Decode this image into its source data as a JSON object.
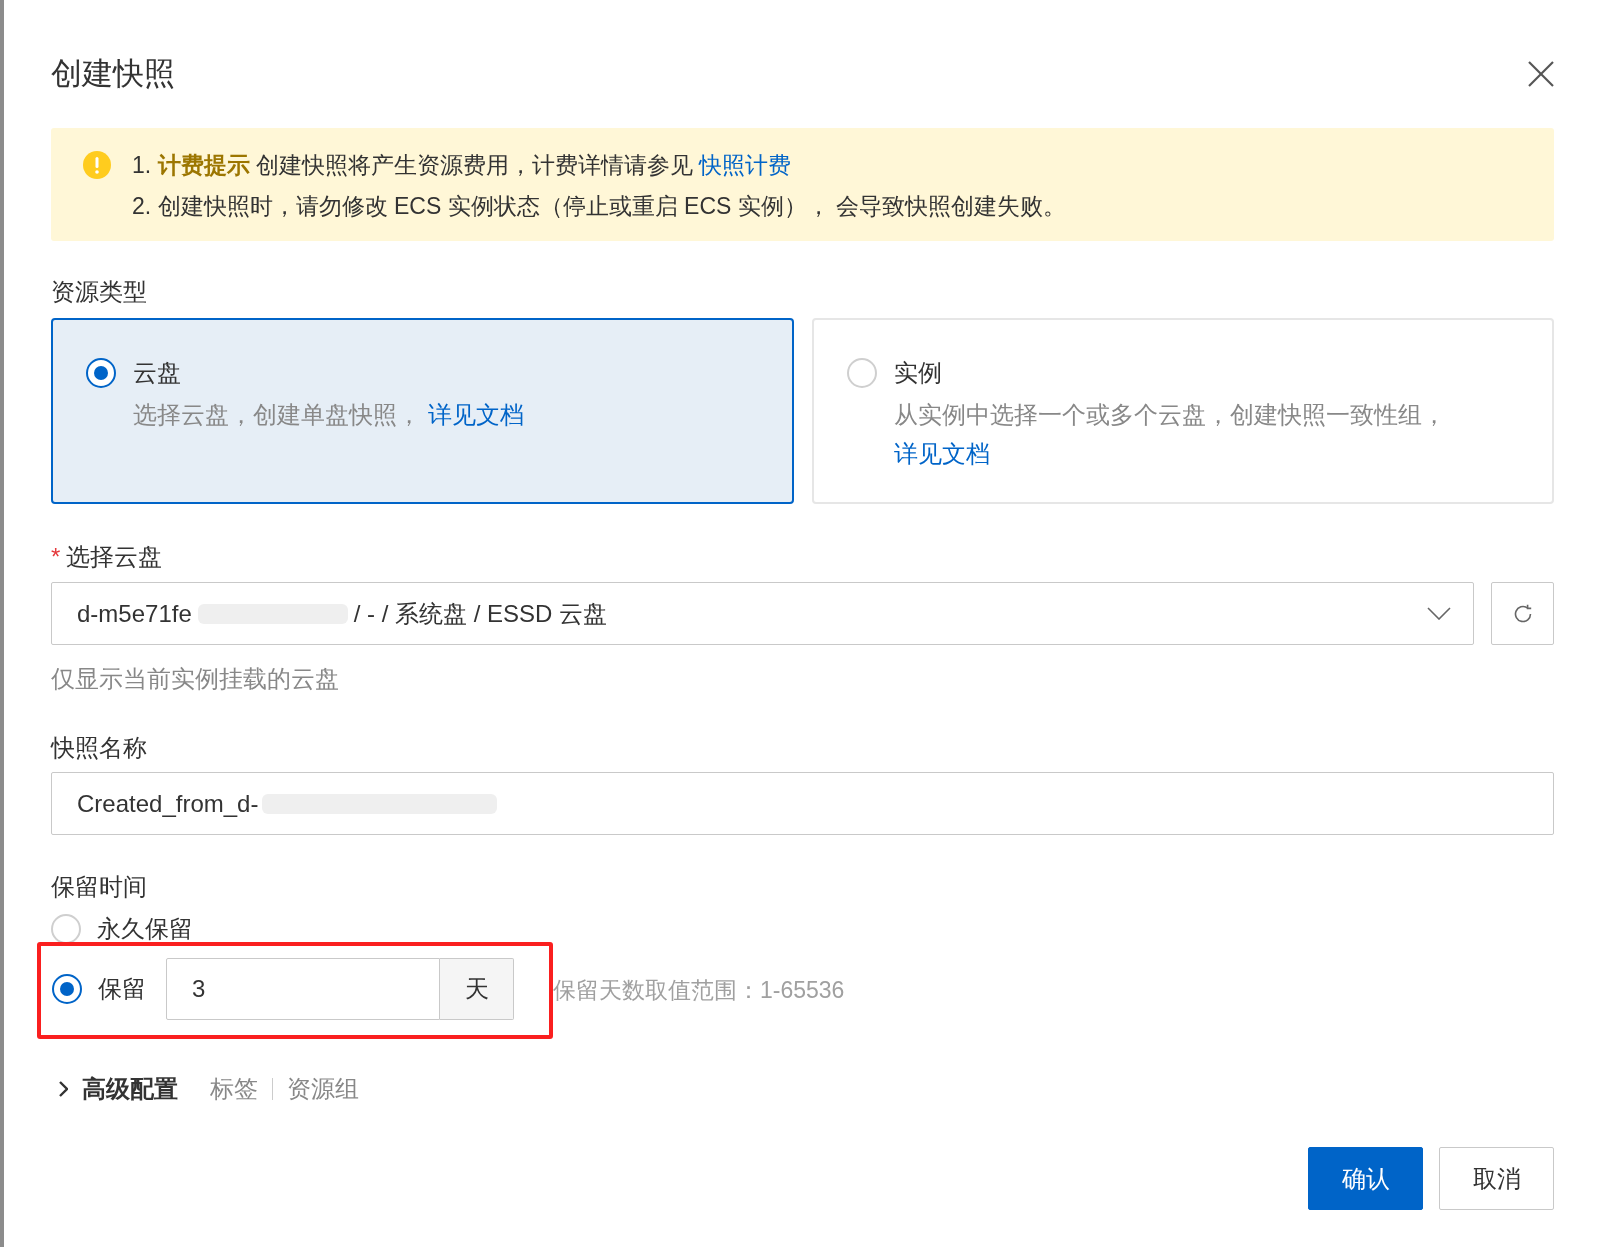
{
  "dialog": {
    "title": "创建快照"
  },
  "notice": {
    "lines": [
      {
        "number": "1.",
        "label": "计费提示",
        "text": "创建快照将产生资源费用，计费详情请参见",
        "link": "快照计费"
      },
      {
        "number": "2.",
        "text": "创建快照时，请勿修改 ECS 实例状态（停止或重启 ECS 实例）， 会导致快照创建失败。"
      }
    ]
  },
  "resource_type": {
    "label": "资源类型",
    "options": [
      {
        "title": "云盘",
        "description": "选择云盘，创建单盘快照，",
        "link": "详见文档",
        "selected": true
      },
      {
        "title": "实例",
        "description": "从实例中选择一个或多个云盘，创建快照一致性组，",
        "link": "详见文档",
        "selected": false
      }
    ]
  },
  "disk_select": {
    "required_mark": "*",
    "label": "选择云盘",
    "value_start": "d-m5e71fe",
    "redacted": true,
    "value_end": "/ - / 系统盘 / ESSD 云盘",
    "help": "仅显示当前实例挂载的云盘"
  },
  "snapshot_name": {
    "label": "快照名称",
    "value_start": "Created_from_d-",
    "redacted": true
  },
  "retention": {
    "label": "保留时间",
    "options": [
      {
        "kind": "permanent",
        "label": "永久保留",
        "selected": false
      },
      {
        "kind": "days",
        "label": "保留",
        "value": "3",
        "unit": "天",
        "hint": "保留天数取值范围：1-65536",
        "selected": true,
        "highlighted": true
      }
    ]
  },
  "advanced": {
    "label": "高级配置",
    "expanded": false,
    "items": [
      "标签",
      "资源组"
    ]
  },
  "buttons": [
    {
      "label": "确认",
      "kind": "primary"
    },
    {
      "label": "取消",
      "kind": "default"
    }
  ]
}
